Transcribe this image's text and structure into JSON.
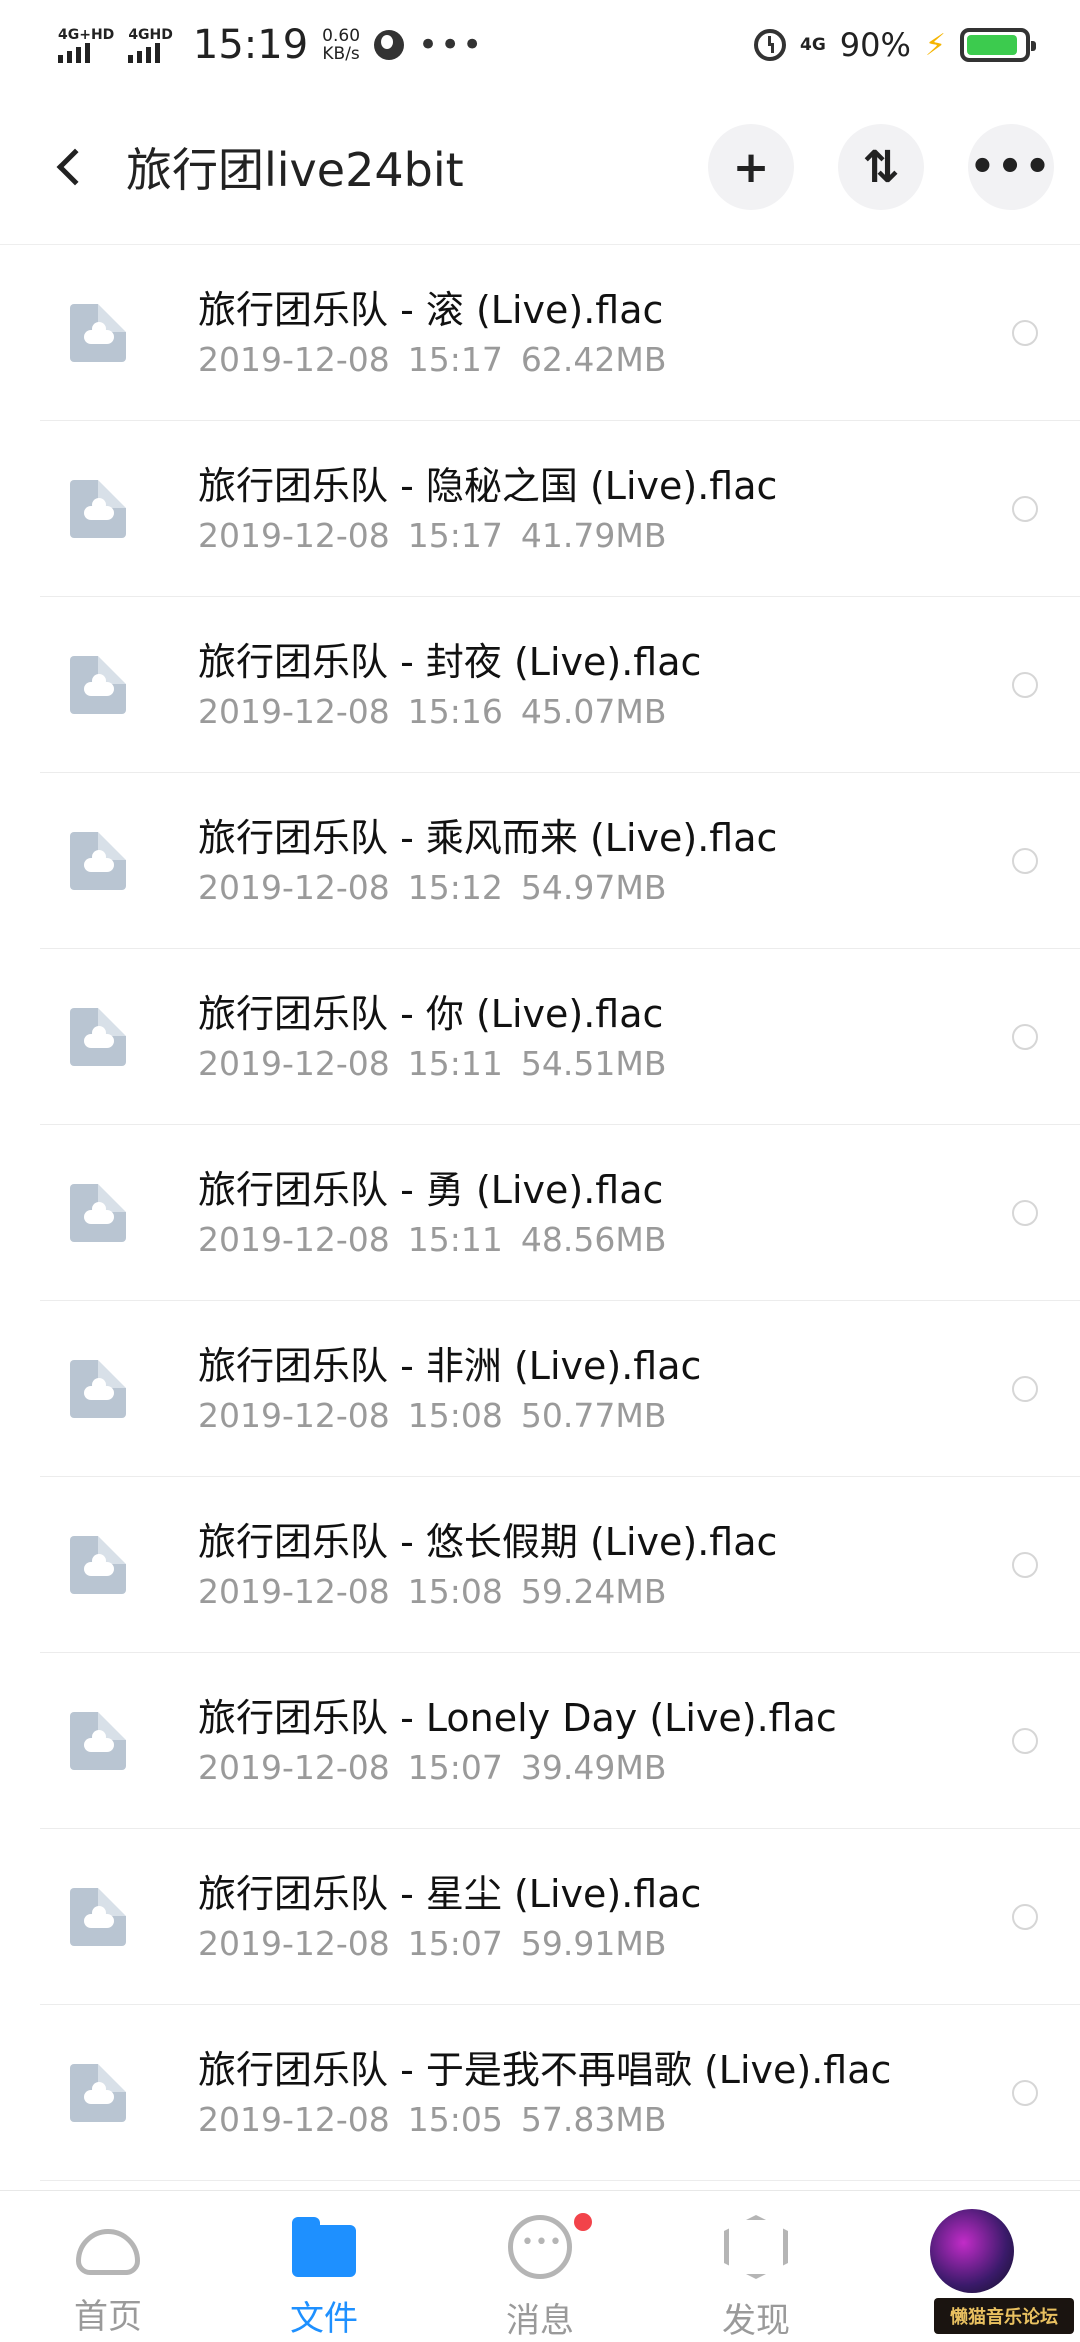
{
  "status_bar": {
    "net1": "4G+HD",
    "net2": "4GHD",
    "time": "15:19",
    "speed_value": "0.60",
    "speed_unit": "KB/s",
    "net3": "4G",
    "battery_pct": "90%",
    "battery_level": 0.9
  },
  "header": {
    "title": "旅行团live24bit",
    "add_icon": "plus-icon",
    "sort_icon": "sort-icon",
    "more_icon": "more-icon"
  },
  "files": [
    {
      "name": "旅行团乐队 - 滚 (Live).flac",
      "date": "2019-12-08",
      "time": "15:17",
      "size": "62.42MB"
    },
    {
      "name": "旅行团乐队 - 隐秘之国 (Live).flac",
      "date": "2019-12-08",
      "time": "15:17",
      "size": "41.79MB"
    },
    {
      "name": "旅行团乐队 - 封夜 (Live).flac",
      "date": "2019-12-08",
      "time": "15:16",
      "size": "45.07MB"
    },
    {
      "name": "旅行团乐队 - 乘风而来 (Live).flac",
      "date": "2019-12-08",
      "time": "15:12",
      "size": "54.97MB"
    },
    {
      "name": "旅行团乐队 - 你 (Live).flac",
      "date": "2019-12-08",
      "time": "15:11",
      "size": "54.51MB"
    },
    {
      "name": "旅行团乐队 - 勇 (Live).flac",
      "date": "2019-12-08",
      "time": "15:11",
      "size": "48.56MB"
    },
    {
      "name": "旅行团乐队 - 非洲 (Live).flac",
      "date": "2019-12-08",
      "time": "15:08",
      "size": "50.77MB"
    },
    {
      "name": "旅行团乐队 - 悠长假期 (Live).flac",
      "date": "2019-12-08",
      "time": "15:08",
      "size": "59.24MB"
    },
    {
      "name": "旅行团乐队 - Lonely Day (Live).flac",
      "date": "2019-12-08",
      "time": "15:07",
      "size": "39.49MB"
    },
    {
      "name": "旅行团乐队 - 星尘 (Live).flac",
      "date": "2019-12-08",
      "time": "15:07",
      "size": "59.91MB"
    },
    {
      "name": "旅行团乐队 - 于是我不再唱歌 (Live).flac",
      "date": "2019-12-08",
      "time": "15:05",
      "size": "57.83MB"
    }
  ],
  "tabs": [
    {
      "label": "首页",
      "icon": "home-cloud-icon"
    },
    {
      "label": "文件",
      "icon": "folder-icon"
    },
    {
      "label": "消息",
      "icon": "message-icon"
    },
    {
      "label": "发现",
      "icon": "discover-icon"
    }
  ],
  "watermark": "懒猫音乐论坛",
  "colors": {
    "accent": "#1e90ff",
    "badge": "#f2434a",
    "file_icon": "#b9c5d2",
    "meta_text": "#9a9a9a",
    "battery": "#3ccb4e"
  }
}
